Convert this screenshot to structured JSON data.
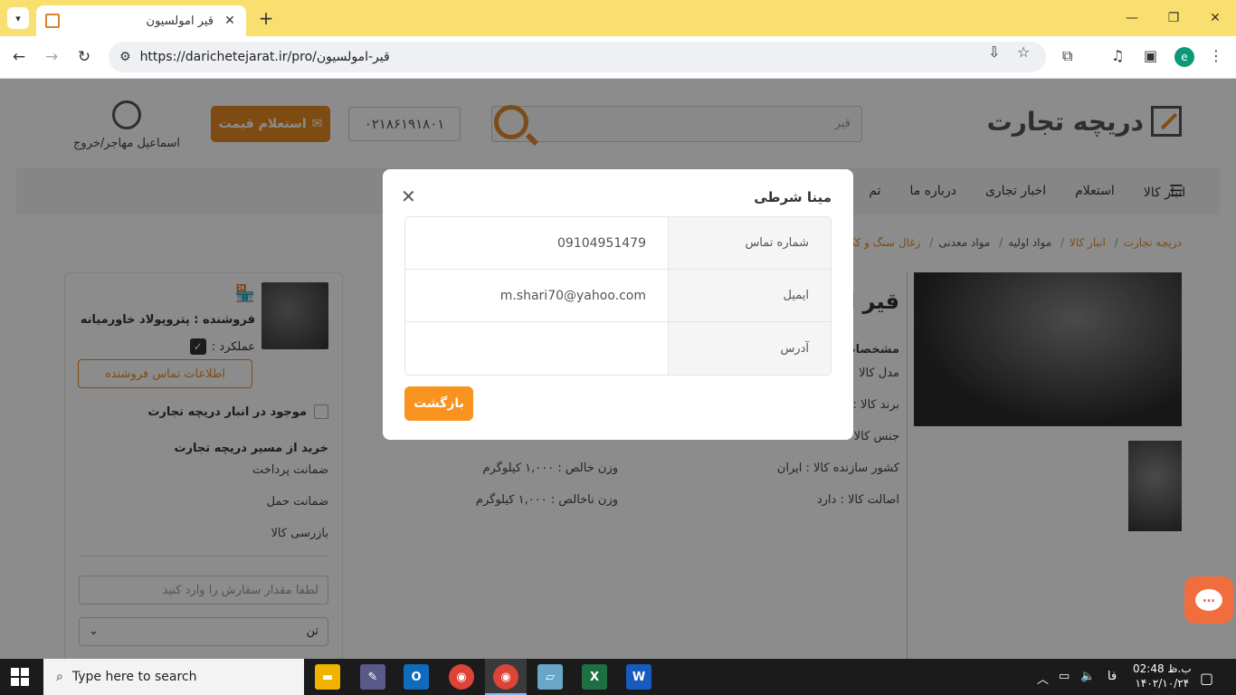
{
  "browser": {
    "tab_title": "قیر امولسیون",
    "url": "https://darichetejarat.ir/pro/قیر-امولسیون"
  },
  "site": {
    "logo_text": "دریچه تجارت",
    "search_placeholder": "قیر",
    "phone": "۰۲۱۸۶۱۹۱۸۰۱",
    "inquiry_button": "استعلام قیمت",
    "user_name": "اسماعیل مهاجر/خروج",
    "menu": [
      "انبار کالا",
      "استعلام",
      "اخبار تجاری",
      "درباره ما",
      "تم"
    ],
    "breadcrumbs": [
      "دریچه تجارت",
      "انبار کالا",
      "مواد اولیه",
      "مواد معدنی",
      "زغال سنگ و کک"
    ]
  },
  "sidebar": {
    "seller": "فروشنده : پتروپولاد خاورمیانه",
    "performance": "عملکرد :",
    "contact_button": "اطلاعات تماس فروشنده",
    "in_stock": "موجود در انبار دریچه تجارت",
    "buy_title": "خرید از مسیر دریچه تجارت",
    "guarantees": [
      "ضمانت پرداخت",
      "ضمانت حمل",
      "بازرسی کالا"
    ],
    "qty_placeholder": "لطفا مقدار سفارش را وارد کنید",
    "unit": "تن"
  },
  "product": {
    "title_partial": "قیر ام",
    "specs_heading": "مشخصات",
    "spec_model": "مدل کالا",
    "spec_brand": "برند کالا :",
    "spec_material": "جنس کالا",
    "spec_country": "کشور سازنده کالا : ایران",
    "spec_original": "اصالت کالا : دارد",
    "spec_net": "وزن خالص : ۱,۰۰۰ کیلوگرم",
    "spec_gross": "وزن ناخالص : ۱,۰۰۰ کیلوگرم"
  },
  "modal": {
    "title": "مینا شرطی",
    "rows": [
      {
        "label": "شماره تماس",
        "value": "09104951479"
      },
      {
        "label": "ایمیل",
        "value": "m.shari70@yahoo.com"
      },
      {
        "label": "آدرس",
        "value": ""
      }
    ],
    "back_button": "بازگشت"
  },
  "taskbar": {
    "search_placeholder": "Type here to search",
    "lang": "فا",
    "time": "02:48 ب.ظ",
    "date": "۱۴۰۲/۱۰/۲۴"
  },
  "colors": {
    "accent": "#f7931e",
    "chrome": "#f9df6f"
  }
}
